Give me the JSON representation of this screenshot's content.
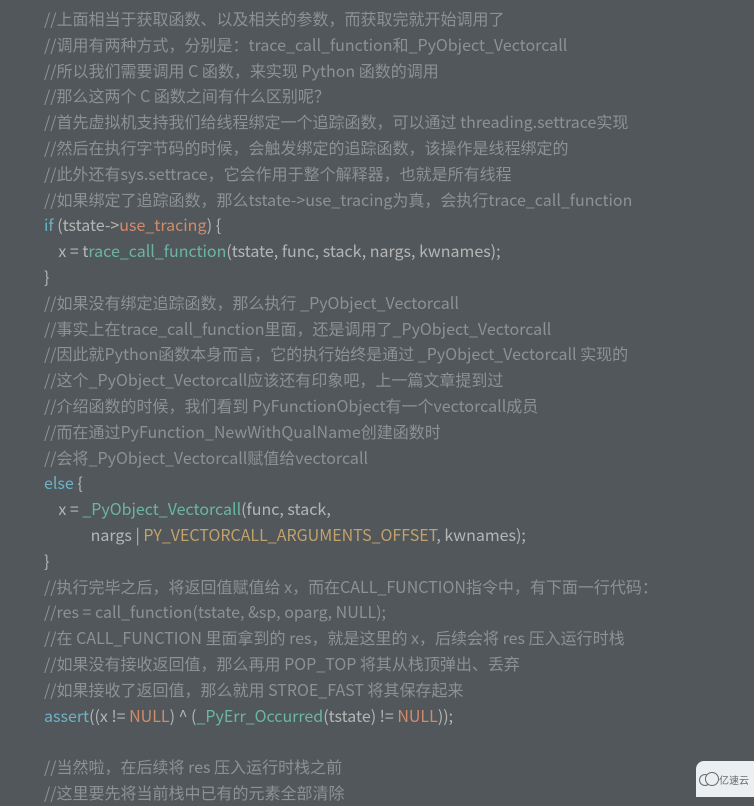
{
  "code": {
    "cm01": "//上面相当于获取函数、以及相关的参数，而获取完就开始调用了",
    "cm02": "//调用有两种方式，分别是：trace_call_function和_PyObject_Vectorcall",
    "cm03": "//所以我们需要调用 C 函数，来实现 Python 函数的调用",
    "cm04": "//那么这两个 C 函数之间有什么区别呢？",
    "cm05": "//首先虚拟机支持我们给线程绑定一个追踪函数，可以通过 threading.settrace实现",
    "cm06": "//然后在执行字节码的时候，会触发绑定的追踪函数，该操作是线程绑定的",
    "cm07": "//此外还有sys.settrace，它会作用于整个解释器，也就是所有线程",
    "cm08": "//如果绑定了追踪函数，那么tstate->use_tracing为真，会执行trace_call_function",
    "if_kw": "if",
    "if_lp": " (",
    "if_tstate": "tstate",
    "if_arrow": "->",
    "if_use_tracing": "use_tracing",
    "if_rp": ") {",
    "assign1a": "    x = t",
    "assign1b": "race_call_function",
    "assign1_args": "(tstate, func, stack, nargs, kwnames);",
    "brace_close1": "}",
    "cm09": "//如果没有绑定追踪函数，那么执行 _PyObject_Vectorcall",
    "cm10": "//事实上在trace_call_function里面，还是调用了_PyObject_Vectorcall",
    "cm11": "//因此就Python函数本身而言，它的执行始终是通过 _PyObject_Vectorcall 实现的",
    "cm12": "//这个_PyObject_Vectorcall应该还有印象吧，上一篇文章提到过",
    "cm13": "//介绍函数的时候，我们看到 PyFunctionObject有一个vectorcall成员",
    "cm14": "//而在通过PyFunction_NewWithQualName创建函数时",
    "cm15": "//会将_PyObject_Vectorcall赋值给vectorcall",
    "else_kw": "else",
    "else_brace": " {",
    "assign2a": "    x = ",
    "assign2b": "_PyObject_Vectorcall",
    "assign2_args1": "(func, stack,",
    "assign2_indent": "             nargs | ",
    "assign2_macro": "PY_VECTORCALL_ARGUMENTS_OFFSET",
    "assign2_args2": ", kwnames);",
    "brace_close2": "}",
    "cm16": "//执行完毕之后，将返回值赋值给 x，而在CALL_FUNCTION指令中，有下面一行代码：",
    "cm17": "//res = call_function(tstate, &sp, oparg, NULL);",
    "cm18": "//在 CALL_FUNCTION 里面拿到的 res，就是这里的 x，后续会将 res 压入运行时栈",
    "cm19": "//如果没有接收返回值，那么再用 POP_TOP 将其从栈顶弹出、丢弃",
    "cm20": "//如果接收了返回值，那么就用 STROE_FAST 将其保存起来",
    "assert_kw": "assert",
    "assert_a": "((x != ",
    "assert_null1": "NULL",
    "assert_b": ") ^ (",
    "assert_fn": "_PyErr_Occurred",
    "assert_c": "(tstate) != ",
    "assert_null2": "NULL",
    "assert_d": "));",
    "blank": "",
    "cm21": "//当然啦，在后续将 res 压入运行时栈之前",
    "cm22": "//这里要先将当前栈中已有的元素全部清除"
  },
  "watermark": {
    "text": "亿速云"
  }
}
